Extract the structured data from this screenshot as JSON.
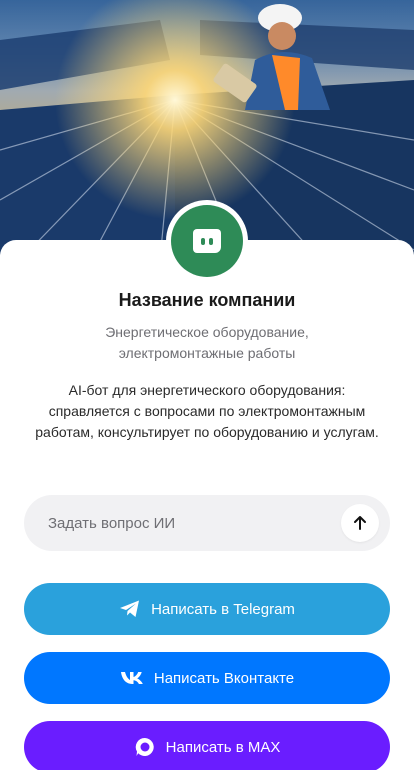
{
  "hero": {
    "image": "solar-panels-worker-photo"
  },
  "company": {
    "name": "Название компании",
    "subtitle": "Энергетическое оборудование, электромонтажные работы",
    "avatar_icon": "chat-bot-icon",
    "avatar_color": "#2e8b57"
  },
  "description": "AI-бот для энергетического оборудования: справляется с вопросами по электромонтажным работам, консультирует по оборудованию и услугам.",
  "ask": {
    "placeholder": "Задать вопрос ИИ",
    "value": "",
    "send_icon": "arrow-up-icon"
  },
  "buttons": {
    "telegram": {
      "label": "Написать в Telegram",
      "color": "#2aa1dc",
      "icon": "telegram-icon"
    },
    "vk": {
      "label": "Написать Вконтакте",
      "color": "#0077ff",
      "icon": "vk-icon"
    },
    "max": {
      "label": "Написать в MAX",
      "color": "#6a1dff",
      "icon": "max-icon"
    }
  }
}
